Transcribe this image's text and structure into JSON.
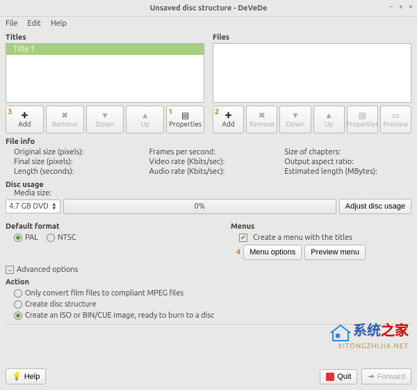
{
  "window": {
    "title": "Unsaved disc structure - DeVeDe"
  },
  "menubar": {
    "file": "File",
    "edit": "Edit",
    "help": "Help"
  },
  "titles": {
    "label": "Titles",
    "items": [
      "Title 1"
    ],
    "buttons": {
      "add": "Add",
      "remove": "Remove",
      "down": "Down",
      "up": "Up",
      "properties": "Properties"
    },
    "badges": {
      "add": "3",
      "properties": "1"
    }
  },
  "files": {
    "label": "Files",
    "items": [],
    "buttons": {
      "add": "Add",
      "remove": "Remove",
      "down": "Down",
      "up": "Up",
      "properties": "Properties",
      "preview": "Preview"
    },
    "badges": {
      "add": "2"
    }
  },
  "fileinfo": {
    "label": "File info",
    "col1": {
      "original_size": "Original size (pixels):",
      "final_size": "Final size (pixels):",
      "length": "Length (seconds):"
    },
    "col2": {
      "fps": "Frames per second:",
      "vrate": "Video rate (Kbits/sec):",
      "arate": "Audio rate (Kbits/sec):"
    },
    "col3": {
      "chapters": "Size of chapters:",
      "aspect": "Output aspect ratio:",
      "estlen": "Estimated length (MBytes):"
    }
  },
  "disc": {
    "label": "Disc usage",
    "media_label": "Media size:",
    "media_value": "4.7 GB DVD",
    "progress": "0%",
    "adjust": "Adjust disc usage"
  },
  "format": {
    "label": "Default format",
    "pal": "PAL",
    "ntsc": "NTSC"
  },
  "menus": {
    "label": "Menus",
    "create": "Create a menu with the titles",
    "options": "Menu options",
    "preview": "Preview menu",
    "badge": "4"
  },
  "advanced": {
    "label": "Advanced options"
  },
  "action": {
    "label": "Action",
    "opt1": "Only convert film files to compliant MPEG files",
    "opt2": "Create disc structure",
    "opt3": "Create an ISO or BIN/CUE image, ready to burn to a disc"
  },
  "footer": {
    "help": "Help",
    "quit": "Quit",
    "forward": "Forward"
  },
  "watermark": {
    "cn1": "系统",
    "cn2": "之家",
    "url": "XITONGZHIJIA.NET"
  }
}
